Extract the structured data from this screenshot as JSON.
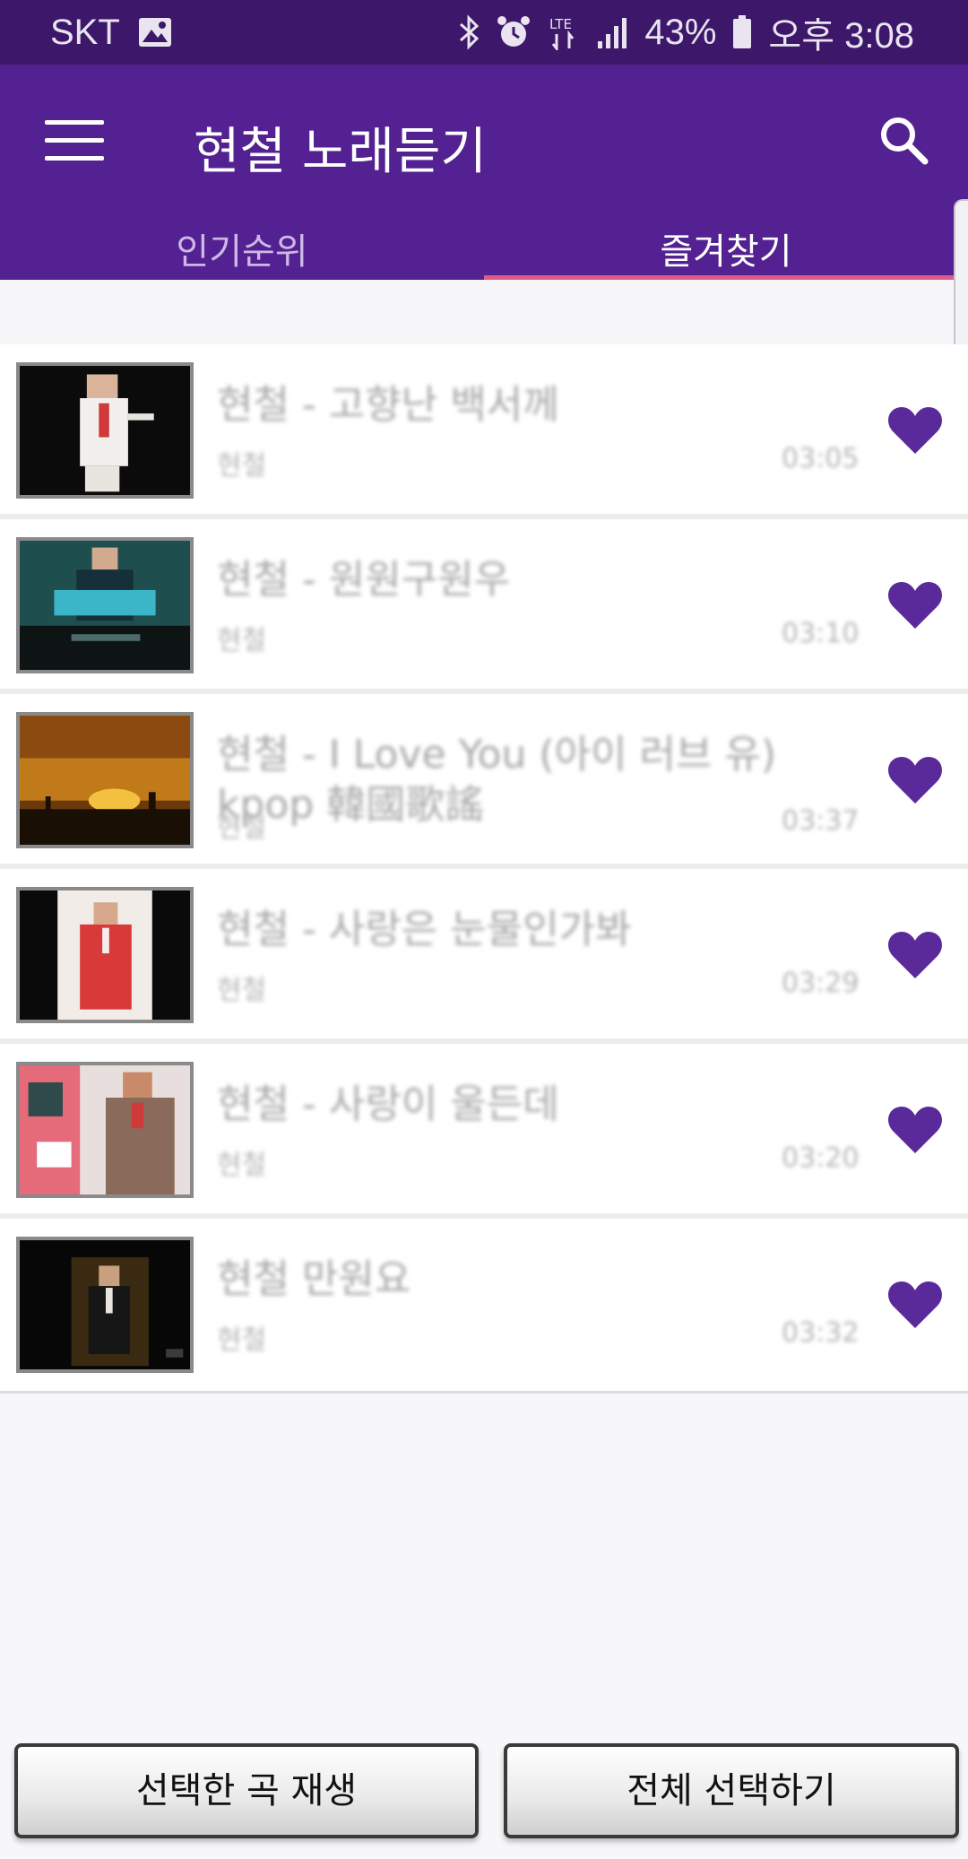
{
  "status_bar": {
    "carrier": "SKT",
    "battery": "43%",
    "time": "오후 3:08",
    "icons": [
      "image-icon",
      "bluetooth-icon",
      "alarm-icon",
      "lte-icon",
      "signal-icon",
      "battery-icon"
    ]
  },
  "app_bar": {
    "title": "현철 노래듣기",
    "icons": [
      "menu-icon",
      "search-icon"
    ]
  },
  "tabs": [
    {
      "label": "인기순위",
      "active": false
    },
    {
      "label": "즐겨찾기",
      "active": true
    }
  ],
  "songs": [
    {
      "title": "현철 - 고향난 백서께",
      "artist": "현철",
      "duration": "03:05",
      "favorite": true
    },
    {
      "title": "현철 - 원원구원우",
      "artist": "현철",
      "duration": "03:10",
      "favorite": true
    },
    {
      "title": "현철 - I Love You (아이 러브 유) kpop 韓國歌謠",
      "artist": "현철",
      "duration": "03:37",
      "favorite": true
    },
    {
      "title": "현철 - 사랑은 눈물인가봐",
      "artist": "현철",
      "duration": "03:29",
      "favorite": true
    },
    {
      "title": "현철 - 사랑이 울든데",
      "artist": "현철",
      "duration": "03:20",
      "favorite": true
    },
    {
      "title": "현철 만원요",
      "artist": "현철",
      "duration": "03:32",
      "favorite": true
    }
  ],
  "bottom_buttons": {
    "play_selected": "선택한 곡 재생",
    "select_all": "전체 선택하기"
  },
  "colors": {
    "primary": "#542192",
    "status_bar": "#3d1769",
    "tab_indicator": "#e05a87",
    "heart": "#5a2a9a"
  }
}
